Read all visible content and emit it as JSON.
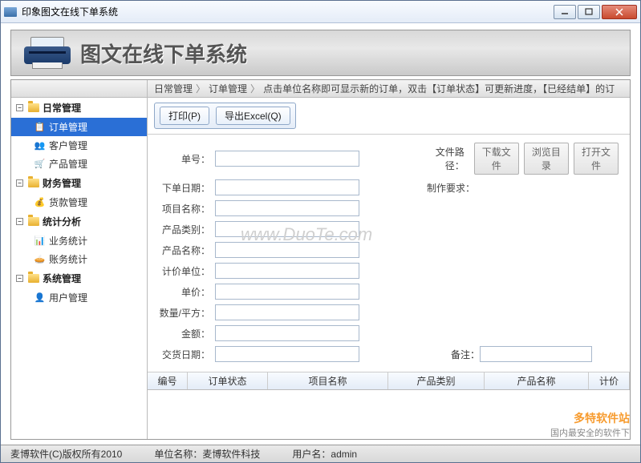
{
  "window": {
    "title": "印象图文在线下单系统"
  },
  "banner": {
    "title": "图文在线下单系统"
  },
  "sidebar": {
    "groups": [
      {
        "title": "日常管理",
        "items": [
          {
            "label": "订单管理",
            "active": true
          },
          {
            "label": "客户管理"
          },
          {
            "label": "产品管理"
          }
        ]
      },
      {
        "title": "财务管理",
        "items": [
          {
            "label": "货款管理"
          }
        ]
      },
      {
        "title": "统计分析",
        "items": [
          {
            "label": "业务统计"
          },
          {
            "label": "账务统计"
          }
        ]
      },
      {
        "title": "系统管理",
        "items": [
          {
            "label": "用户管理"
          }
        ]
      }
    ]
  },
  "breadcrumb": {
    "a": "日常管理",
    "b": "订单管理",
    "hint": "点击单位名称即可显示新的订单，双击【订单状态】可更新进度，【已经结单】的订"
  },
  "toolbar": {
    "print": "打印(P)",
    "export": "导出Excel(Q)"
  },
  "form": {
    "labels": {
      "order_no": "单号：",
      "order_date": "下单日期：",
      "project": "项目名称：",
      "category": "产品类别：",
      "product": "产品名称：",
      "unit": "计价单位：",
      "price": "单价：",
      "qty": "数量/平方：",
      "amount": "金额：",
      "delivery": "交货日期：",
      "filepath": "文件路径：",
      "requirement": "制作要求：",
      "remark": "备注："
    },
    "buttons": {
      "download": "下载文件",
      "browse": "浏览目录",
      "open": "打开文件"
    },
    "values": {
      "order_no": "",
      "order_date": "",
      "project": "",
      "category": "",
      "product": "",
      "unit": "",
      "price": "",
      "qty": "",
      "amount": "",
      "delivery": "",
      "filepath": "",
      "requirement": "",
      "remark": ""
    }
  },
  "table": {
    "columns": [
      "编号",
      "订单状态",
      "项目名称",
      "产品类别",
      "产品名称",
      "计价"
    ]
  },
  "footer": {
    "copyright": "麦博软件(C)版权所有2010",
    "company_label": "单位名称：",
    "company": "麦博软件科技",
    "user_label": "用户名：",
    "user": "admin"
  },
  "overlay": {
    "watermark": "www.DuoTe.com",
    "duote_big": "多特软件站",
    "duote_small": "国内最安全的软件下",
    "duote_url": "www.DuoTe.com"
  }
}
